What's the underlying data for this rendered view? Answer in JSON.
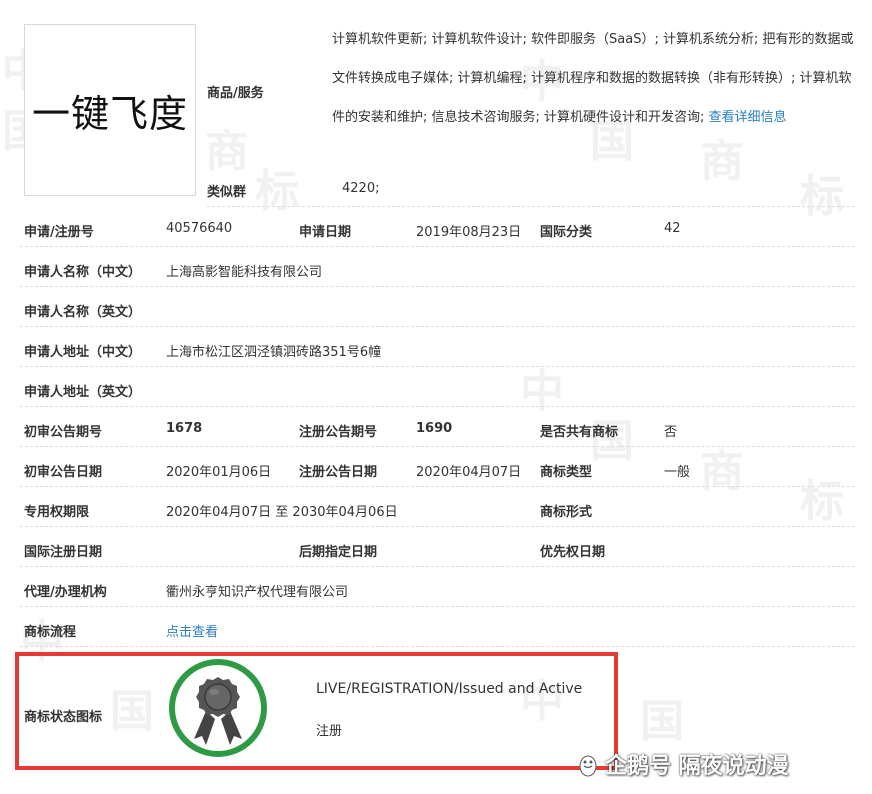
{
  "logo_text": "一键飞度",
  "goods": {
    "label": "商品/服务",
    "text": "计算机软件更新; 计算机软件设计; 软件即服务（SaaS）; 计算机系统分析; 把有形的数据或文件转换成电子媒体; 计算机编程; 计算机程序和数据的数据转换（非有形转换）; 计算机软件的安装和维护; 信息技术咨询服务; 计算机硬件设计和开发咨询; ",
    "link": "查看详细信息"
  },
  "similar": {
    "label": "类似群",
    "value": "4220;"
  },
  "reg": {
    "no_label": "申请/注册号",
    "no_value": "40576640",
    "date_label": "申请日期",
    "date_value": "2019年08月23日",
    "class_label": "国际分类",
    "class_value": "42"
  },
  "applicant": {
    "name_cn_label": "申请人名称（中文）",
    "name_cn_value": "上海高影智能科技有限公司",
    "name_en_label": "申请人名称（英文）",
    "addr_cn_label": "申请人地址（中文）",
    "addr_cn_value": "上海市松江区泗泾镇泗砖路351号6幢",
    "addr_en_label": "申请人地址（英文）"
  },
  "announce": {
    "prelim_no_label": "初审公告期号",
    "prelim_no_value": "1678",
    "reg_no_label": "注册公告期号",
    "reg_no_value": "1690",
    "shared_label": "是否共有商标",
    "shared_value": "否",
    "prelim_date_label": "初审公告日期",
    "prelim_date_value": "2020年01月06日",
    "reg_date_label": "注册公告日期",
    "reg_date_value": "2020年04月07日",
    "type_label": "商标类型",
    "type_value": "一般"
  },
  "rights": {
    "period_label": "专用权期限",
    "period_value": "2020年04月07日 至 2030年04月06日",
    "form_label": "商标形式"
  },
  "dates": {
    "intl_label": "国际注册日期",
    "later_label": "后期指定日期",
    "priority_label": "优先权日期"
  },
  "agent": {
    "label": "代理/办理机构",
    "value": "衢州永亨知识产权代理有限公司"
  },
  "flow": {
    "label": "商标流程",
    "link": "点击查看"
  },
  "status": {
    "label": "商标状态图标",
    "en": "LIVE/REGISTRATION/Issued and Active",
    "cn": "注册"
  },
  "watermark": "企鹅号 隔夜说动漫",
  "colors": {
    "link": "#2a7fc2",
    "frame": "#e53935",
    "badge_ring": "#2e9a44"
  },
  "icons": {
    "status": "award-ribbon-icon",
    "watermark": "penguin-icon"
  }
}
